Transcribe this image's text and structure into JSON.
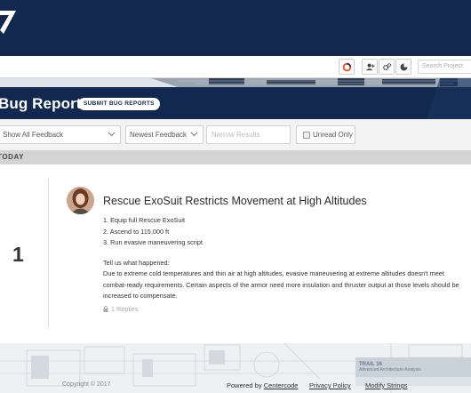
{
  "toolbar": {
    "search_placeholder": "Search Project"
  },
  "header": {
    "title": "Bug Reports",
    "submit_label": "SUBMIT BUG REPORTS"
  },
  "filters": {
    "feedback_filter": "Show All Feedback",
    "sort": "Newest Feedback",
    "narrow_placeholder": "Narrow Results",
    "unread_label": "Unread Only"
  },
  "feed": {
    "group_label": "TODAY",
    "day_number": "1",
    "post": {
      "title": "Rescue ExoSuit Restricts Movement at High Altitudes",
      "steps": [
        "1. Equip full Rescue ExoSuit",
        "2. Ascend to 115,000 ft",
        "3. Run evasive maneuvering script"
      ],
      "prompt": "Tell us what happened:",
      "description": "Due to extreme cold temperatures and thin air at high altitudes, evasive maneuvering at extreme altitudes doesn't meet combat-ready requirements. Certain aspects of the armor need more insulation and thruster output at those levels should be increased to compensate.",
      "replies": "1 Replies"
    }
  },
  "footer": {
    "copyright": "Copyright © 2017",
    "powered_prefix": "Powered by",
    "powered_link": "Centercode",
    "privacy": "Privacy Policy",
    "modify": "Modify Strings",
    "trail_label": "TRAIL 16",
    "trail_sub": "Advanced Architecture Analysis"
  },
  "colors": {
    "navy": "#12284f",
    "accent_orange": "#e8532b"
  }
}
